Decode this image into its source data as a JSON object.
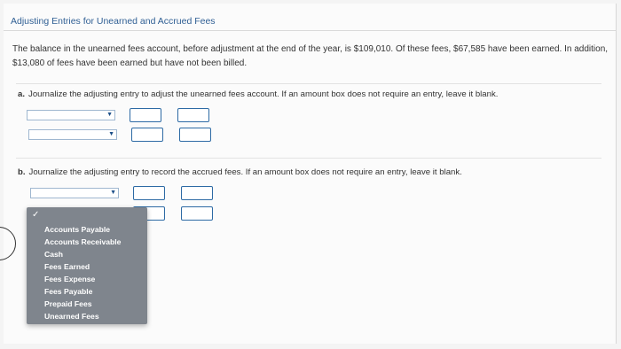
{
  "page": {
    "title": "Adjusting Entries for Unearned and Accrued Fees",
    "intro": "The balance in the unearned fees account, before adjustment at the end of the year, is $109,010. Of these fees, $67,585 have been earned. In addition, $13,080 of fees have been earned but have not been billed."
  },
  "part_a": {
    "marker": "a.",
    "instruction": "Journalize the adjusting entry to adjust the unearned fees account. If an amount box does not require an entry, leave it blank."
  },
  "part_b": {
    "marker": "b.",
    "instruction": "Journalize the adjusting entry to record the accrued fees. If an amount box does not require an entry, leave it blank."
  },
  "dropdown": {
    "checkmark": "✓",
    "options": [
      "Accounts Payable",
      "Accounts Receivable",
      "Cash",
      "Fees Earned",
      "Fees Expense",
      "Fees Payable",
      "Prepaid Fees",
      "Unearned Fees"
    ]
  },
  "icons": {
    "select_arrow": "chevron-down-icon",
    "selected_mark": "check-icon"
  },
  "colors": {
    "title": "#2f5f94",
    "box_border": "#2d6aa4",
    "menu_bg": "#7f858d"
  }
}
